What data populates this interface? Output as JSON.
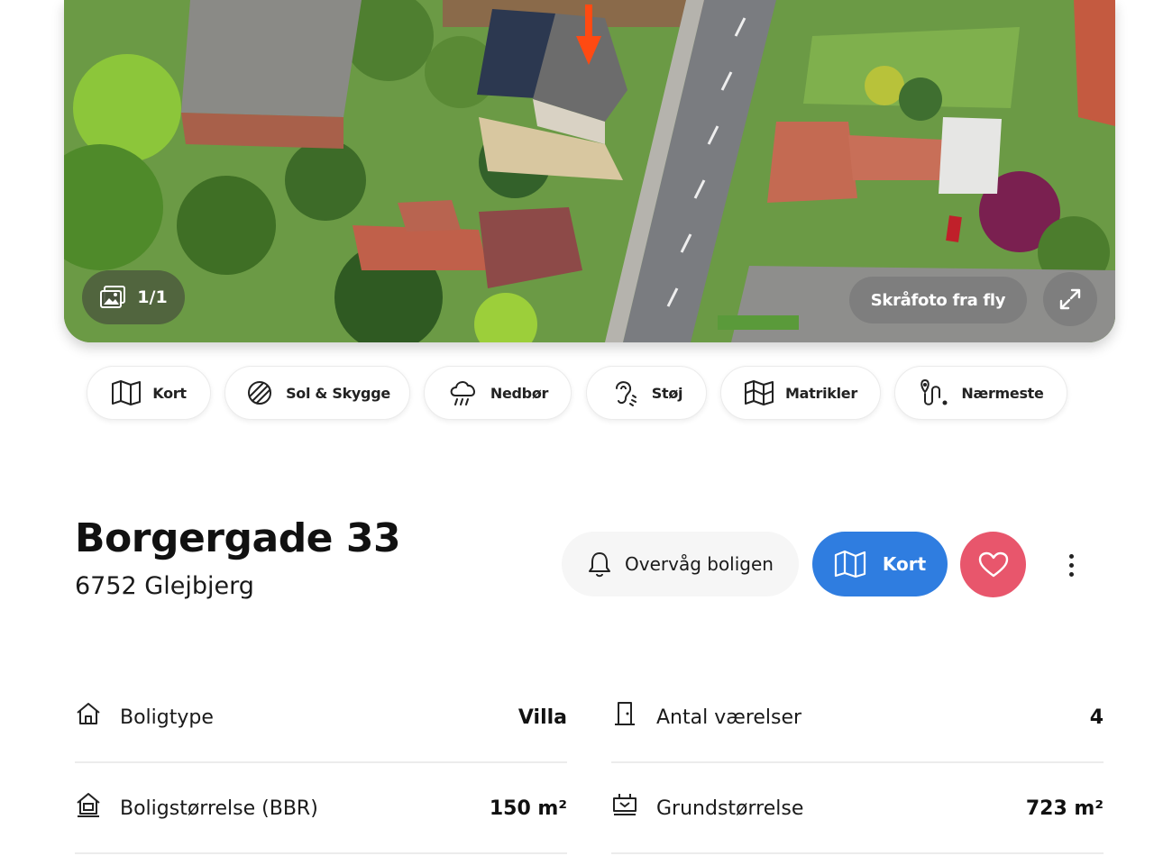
{
  "gallery": {
    "counter": "1/1",
    "oblique_label": "Skråfoto fra fly"
  },
  "chips": [
    {
      "label": "Kort",
      "icon": "map-icon"
    },
    {
      "label": "Sol & Skygge",
      "icon": "sun-shadow-icon"
    },
    {
      "label": "Nedbør",
      "icon": "rain-cloud-icon"
    },
    {
      "label": "Støj",
      "icon": "ear-noise-icon"
    },
    {
      "label": "Matrikler",
      "icon": "parcel-map-icon"
    },
    {
      "label": "Nærmeste",
      "icon": "route-pin-icon"
    }
  ],
  "property": {
    "address": "Borgergade 33",
    "city": "6752 Glejbjerg"
  },
  "actions": {
    "watch_label": "Overvåg boligen",
    "map_label": "Kort"
  },
  "colors": {
    "primary": "#2f7de0",
    "favorite": "#e8566c",
    "marker": "#ff4a12"
  },
  "facts": [
    {
      "label": "Boligtype",
      "value": "Villa",
      "icon": "house-icon"
    },
    {
      "label": "Antal værelser",
      "value": "4",
      "icon": "door-icon"
    },
    {
      "label": "Boligstørrelse (BBR)",
      "value": "150 m²",
      "icon": "house-size-icon"
    },
    {
      "label": "Grundstørrelse",
      "value": "723 m²",
      "icon": "plot-icon"
    }
  ]
}
